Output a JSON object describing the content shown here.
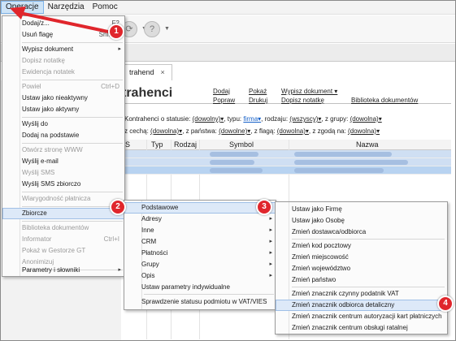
{
  "menubar": {
    "items": [
      "Operacje",
      "Narzędzia",
      "Pomoc"
    ]
  },
  "tab": {
    "label": "trahend",
    "close": "×"
  },
  "page": {
    "title": "trahenci",
    "actions": {
      "dodaj": "Dodaj",
      "popraw": "Popraw",
      "pokaz": "Pokaż",
      "drukuj": "Drukuj",
      "wypisz": "Wypisz dokument ▾",
      "dopisz": "Dopisz notatkę",
      "biblioteka": "Biblioteka dokumentów"
    },
    "filter1": {
      "prefix": "Kontrahenci o statusie:",
      "status": "(dowolny)▾",
      "typ_label": ", typu:",
      "typ": "firma▾",
      "rodzaj_label": ", rodzaju:",
      "rodzaj": "(wszyscy)▾",
      "grupy_label": ", z grupy:",
      "grupy": "(dowolna)▾"
    },
    "filter2": {
      "cecha_label": "z cechą:",
      "cecha": "(dowolna)▾",
      "panstwo_label": ", z państwa:",
      "panstwo": "(dowolne)▾",
      "flaga_label": ", z flagą:",
      "flaga": "(dowolna)▾",
      "zgoda_label": ", z zgodą na:",
      "zgoda": "(dowolna)▾"
    }
  },
  "grid": {
    "headers": [
      "S",
      "Typ",
      "Rodzaj",
      "Symbol",
      "Nazwa"
    ]
  },
  "menu_operacje": {
    "items": [
      {
        "label": "Dodaj/z...",
        "shortcut": "F2",
        "disabled": false
      },
      {
        "label": "Usuń flagę",
        "shortcut": "Shift-...",
        "disabled": false
      },
      {
        "label": "Wypisz dokument",
        "arrow": "▸",
        "disabled": false
      },
      {
        "label": "Dopisz notatkę",
        "disabled": true
      },
      {
        "label": "Ewidencja notatek",
        "disabled": true
      },
      {
        "label": "Powiel",
        "shortcut": "Ctrl+D",
        "disabled": true
      },
      {
        "label": "Ustaw jako nieaktywny",
        "disabled": false
      },
      {
        "label": "Ustaw jako aktywny",
        "disabled": false
      },
      {
        "label": "Wyślij do",
        "disabled": false
      },
      {
        "label": "Dodaj na podstawie",
        "disabled": false
      },
      {
        "label": "Otwórz stronę WWW",
        "disabled": true
      },
      {
        "label": "Wyślij e-mail",
        "disabled": false
      },
      {
        "label": "Wyślij SMS",
        "disabled": true
      },
      {
        "label": "Wyślij SMS zbiorczo",
        "disabled": false
      },
      {
        "label": "Wiarygodność płatnicza",
        "disabled": true
      },
      {
        "label": "Zbiorcze",
        "arrow": "▸",
        "disabled": false
      },
      {
        "label": "Biblioteka dokumentów",
        "disabled": true
      },
      {
        "label": "Informator",
        "shortcut": "Ctrl+I",
        "disabled": true
      },
      {
        "label": "Pokaż w Gestorze GT",
        "disabled": true
      },
      {
        "label": "Anonimizuj",
        "disabled": true
      },
      {
        "label": "Parametry i słowniki",
        "arrow": "▸",
        "disabled": false
      }
    ]
  },
  "menu_zbiorcze": {
    "items": [
      {
        "label": "Podstawowe",
        "arrow": "▸"
      },
      {
        "label": "Adresy",
        "arrow": "▸"
      },
      {
        "label": "Inne",
        "arrow": "▸"
      },
      {
        "label": "CRM",
        "arrow": "▸"
      },
      {
        "label": "Płatności",
        "arrow": "▸"
      },
      {
        "label": "Grupy",
        "arrow": "▸"
      },
      {
        "label": "Opis",
        "arrow": "▸"
      },
      {
        "label": "Ustaw parametry indywidualne"
      },
      {
        "label": "Sprawdzenie statusu podmiotu w VAT/VIES"
      }
    ]
  },
  "menu_podstawowe": {
    "items": [
      {
        "label": "Ustaw jako Firmę"
      },
      {
        "label": "Ustaw jako Osobę"
      },
      {
        "label": "Zmień dostawca/odbiorca"
      },
      {
        "label": "Zmień kod pocztowy"
      },
      {
        "label": "Zmień miejscowość"
      },
      {
        "label": "Zmień województwo"
      },
      {
        "label": "Zmień państwo"
      },
      {
        "label": "Zmień znacznik czynny podatnik VAT"
      },
      {
        "label": "Zmień znacznik odbiorca detaliczny"
      },
      {
        "label": "Zmień znacznik centrum autoryzacji kart płatniczych"
      },
      {
        "label": "Zmień znacznik centrum obsługi ratalnej"
      }
    ]
  },
  "badges": [
    "1",
    "2",
    "3",
    "4"
  ],
  "colors": {
    "accent_red": "#e0262c",
    "highlight": "#dde9f8",
    "selected_row": "#b8d3f1"
  }
}
